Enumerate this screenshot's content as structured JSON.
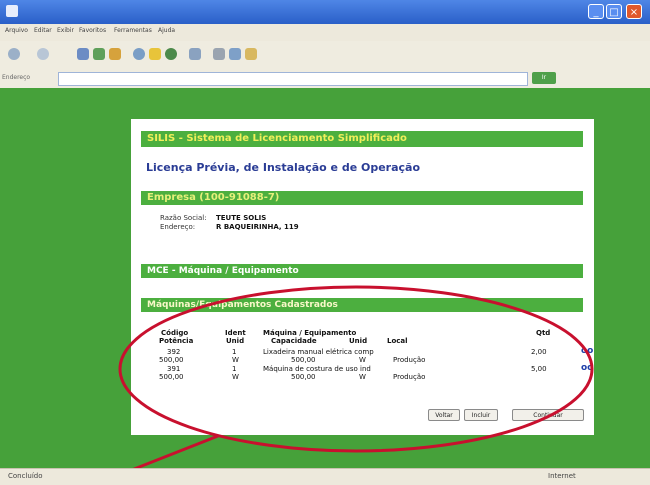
{
  "window": {
    "title": ""
  },
  "menu": [
    "Arquivo",
    "Editar",
    "Exibir",
    "Favoritos",
    "Ferramentas",
    "Ajuda"
  ],
  "address": {
    "label": "Endereço",
    "go": "Ir"
  },
  "status": {
    "left": "Concluído",
    "right": "Internet"
  },
  "page": {
    "app_title": "SILIS - Sistema de Licenciamento Simplificado",
    "subtitle": "Licença Prévia, de Instalação e de Operação",
    "empresa_title": "Empresa (100-91088-7)",
    "razao_label": "Razão Social:",
    "razao_value": "TEUTE SOLIS",
    "endereco_label": "Endereço:",
    "endereco_value": "R BAQUEIRINHA, 119",
    "mce_title": "MCE - Máquina / Equipamento",
    "maq_title": "Máquinas/Equipamentos Cadastrados",
    "headers": {
      "codigo": "Código",
      "potencia": "Potência",
      "ident": "Ident",
      "unid": "Unid",
      "maquina": "Máquina / Equipamento",
      "capacidade": "Capacidade",
      "unid2": "Unid",
      "local": "Local",
      "qtd": "Qtd"
    },
    "rows": [
      {
        "codigo": "392",
        "potencia": "500,00",
        "ident": "1",
        "unid": "W",
        "maquina": "Lixadeira manual elétrica comp",
        "capacidade": "500,00",
        "unid2": "W",
        "local": "Produção",
        "qtd": "2,00"
      },
      {
        "codigo": "391",
        "potencia": "500,00",
        "ident": "1",
        "unid": "W",
        "maquina": "Máquina de costura de uso ind",
        "capacidade": "500,00",
        "unid2": "W",
        "local": "Produção",
        "qtd": "5,00"
      }
    ],
    "action_icon": "oo",
    "buttons": {
      "voltar": "Voltar",
      "incluir": "Incluir",
      "continuar": "Continuar"
    }
  },
  "colors": {
    "page_bg": "#46a13a",
    "bar_green": "#4caf3f",
    "annotation": "#c8102e",
    "titlebar": "#2a5fc8"
  },
  "icons": {
    "back": "back-arrow-icon",
    "forward": "forward-arrow-icon",
    "action": "link-glasses-icon"
  }
}
